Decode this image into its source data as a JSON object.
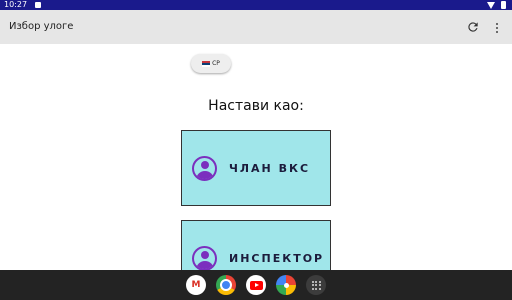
{
  "status_bar": {
    "time": "10:27"
  },
  "app_bar": {
    "title": "Избор улоге",
    "refresh_icon": "refresh-icon",
    "menu_icon": "more-vert-icon"
  },
  "language_chip": {
    "label": "СР",
    "flag_colors": [
      "#c6363c",
      "#0c4076",
      "#ffffff"
    ]
  },
  "prompt": "Настави као:",
  "roles": [
    {
      "label": "ЧЛАН ВКС",
      "icon": "user-avatar-icon"
    },
    {
      "label": "ИНСПЕКТОР",
      "icon": "user-avatar-icon"
    }
  ],
  "dock": {
    "apps": [
      "Gmail",
      "Chrome",
      "YouTube",
      "Photos",
      "All apps"
    ],
    "gmail_glyph": "M"
  },
  "colors": {
    "card_bg": "#a0e6ea",
    "accent": "#7b2fbe",
    "status_bar": "#1a1a8c",
    "app_bar": "#e6e6e6"
  }
}
